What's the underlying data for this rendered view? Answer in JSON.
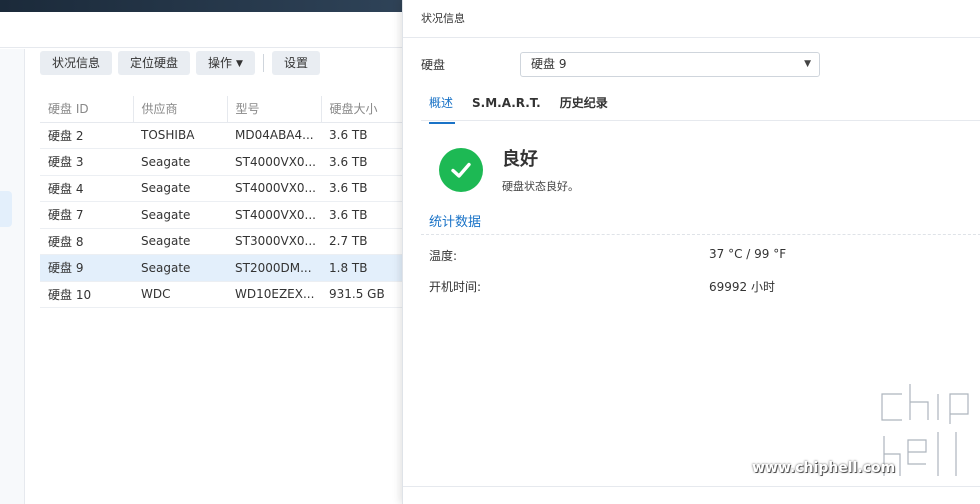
{
  "toolbar": {
    "status_info": "状况信息",
    "locate_disk": "定位硬盘",
    "actions": "操作",
    "settings": "设置"
  },
  "table": {
    "headers": [
      "硬盘 ID",
      "供应商",
      "型号",
      "硬盘大小"
    ],
    "rows": [
      [
        "硬盘 2",
        "TOSHIBA",
        "MD04ABA4...",
        "3.6 TB"
      ],
      [
        "硬盘 3",
        "Seagate",
        "ST4000VX0...",
        "3.6 TB"
      ],
      [
        "硬盘 4",
        "Seagate",
        "ST4000VX0...",
        "3.6 TB"
      ],
      [
        "硬盘 7",
        "Seagate",
        "ST4000VX0...",
        "3.6 TB"
      ],
      [
        "硬盘 8",
        "Seagate",
        "ST3000VX0...",
        "2.7 TB"
      ],
      [
        "硬盘 9",
        "Seagate",
        "ST2000DM...",
        "1.8 TB"
      ],
      [
        "硬盘 10",
        "WDC",
        "WD10EZEX...",
        "931.5 GB"
      ]
    ],
    "selected_row": 5
  },
  "panel": {
    "title": "状况信息",
    "disk_label": "硬盘",
    "disk_selected": "硬盘 9",
    "tabs": [
      "概述",
      "S.M.A.R.T.",
      "历史纪录"
    ],
    "active_tab": 0,
    "status_title": "良好",
    "status_desc": "硬盘状态良好。",
    "stats_title": "统计数据",
    "stats": [
      {
        "key": "温度:",
        "value": "37 °C / 99 °F"
      },
      {
        "key": "开机时间:",
        "value": "69992 小时"
      }
    ],
    "status_color": "#1db954",
    "accent_color": "#1a73c7"
  },
  "watermark": {
    "site": "www.chiphell.com",
    "logo_text": "chip hell"
  }
}
